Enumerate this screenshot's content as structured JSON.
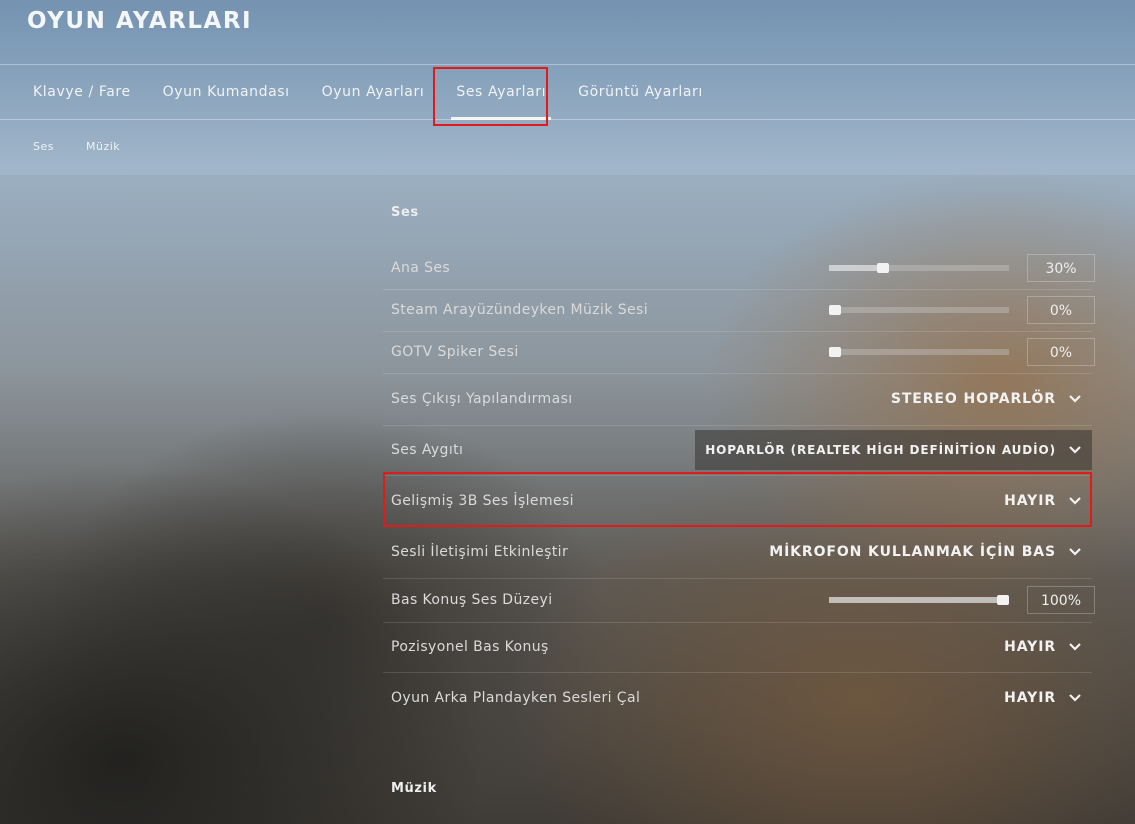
{
  "header": {
    "title": "OYUN AYARLARI"
  },
  "tabs": [
    {
      "label": "Klavye / Fare"
    },
    {
      "label": "Oyun Kumandası"
    },
    {
      "label": "Oyun Ayarları"
    },
    {
      "label": "Ses Ayarları",
      "active": true
    },
    {
      "label": "Görüntü Ayarları"
    }
  ],
  "subtabs": [
    {
      "label": "Ses"
    },
    {
      "label": "Müzik"
    }
  ],
  "sections": {
    "ses": "Ses",
    "muzik": "Müzik"
  },
  "settings": {
    "ana_ses": {
      "label": "Ana Ses",
      "value": "30%",
      "level": 0.3
    },
    "steam_muzik": {
      "label": "Steam Arayüzündeyken Müzik Sesi",
      "value": "0%",
      "level": 0
    },
    "gotv_spiker": {
      "label": "GOTV Spiker Sesi",
      "value": "0%",
      "level": 0
    },
    "ses_cikisi": {
      "label": "Ses Çıkışı Yapılandırması",
      "value": "STEREO HOPARLÖR"
    },
    "ses_aygiti": {
      "label": "Ses Aygıtı",
      "value": "HOPARLÖR (REALTEK HİGH DEFİNİTİON AUDİO)"
    },
    "gelismis_3b": {
      "label": "Gelişmiş 3B Ses İşlemesi",
      "value": "HAYIR"
    },
    "sesli_iletisim": {
      "label": "Sesli İletişimi Etkinleştir",
      "value": "MİKROFON KULLANMAK İÇİN BAS"
    },
    "bas_konus_duzey": {
      "label": "Bas Konuş Ses Düzeyi",
      "value": "100%",
      "level": 1.0
    },
    "pozisyonel": {
      "label": "Pozisyonel Bas Konuş",
      "value": "HAYIR"
    },
    "arka_plan": {
      "label": "Oyun Arka Plandayken Sesleri Çal",
      "value": "HAYIR"
    }
  },
  "colors": {
    "highlight": "#e11b1b"
  }
}
